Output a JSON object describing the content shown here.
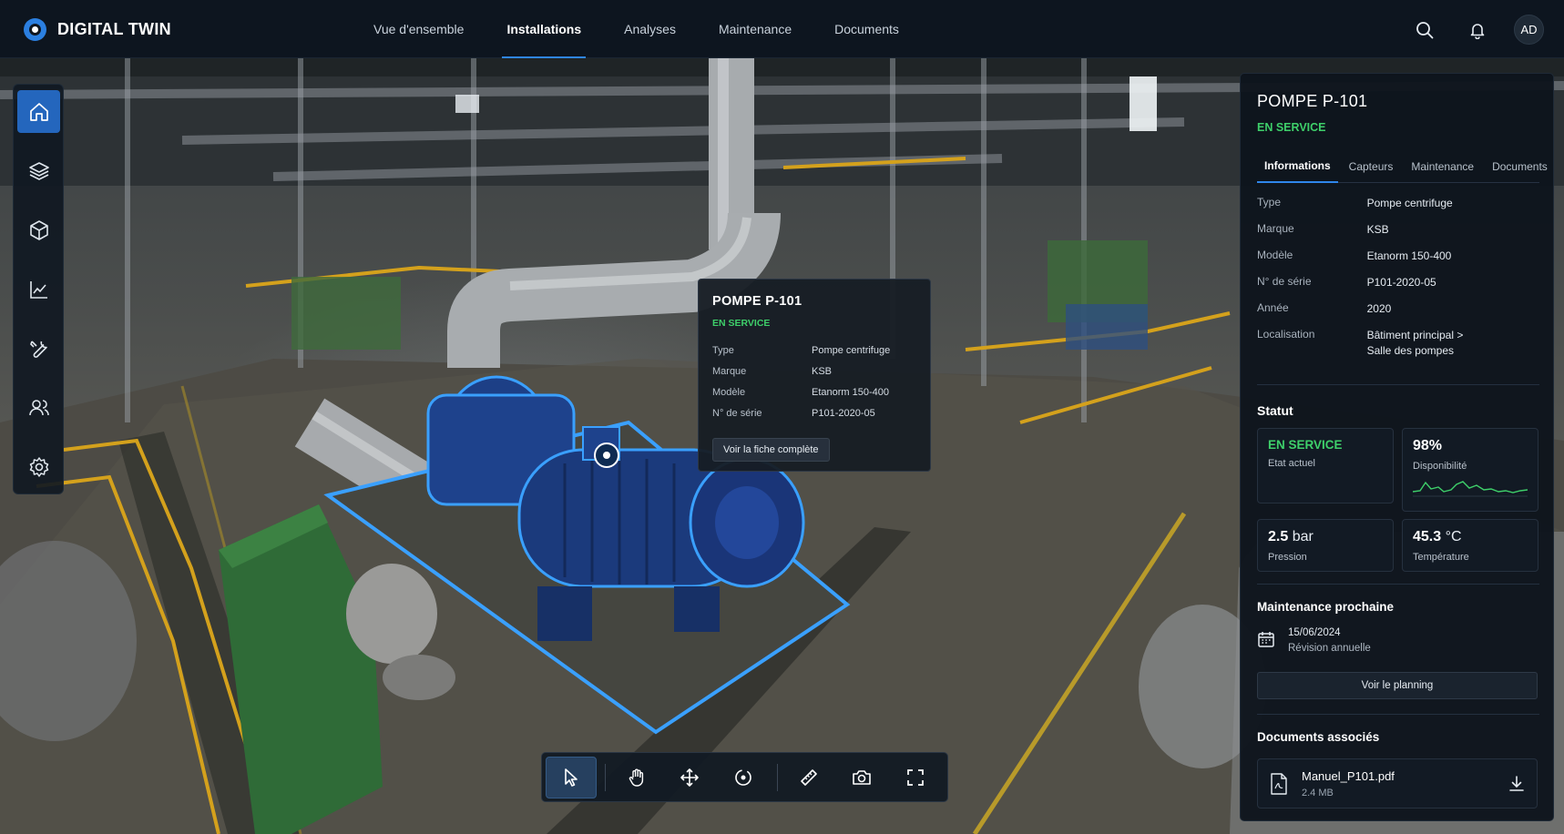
{
  "app": {
    "brand": "DIGITAL TWIN"
  },
  "nav": {
    "items": [
      {
        "label": "Vue d'ensemble",
        "active": false
      },
      {
        "label": "Installations",
        "active": true
      },
      {
        "label": "Analyses",
        "active": false
      },
      {
        "label": "Maintenance",
        "active": false
      },
      {
        "label": "Documents",
        "active": false
      }
    ]
  },
  "user": {
    "initials": "AD"
  },
  "left_rail": {
    "items": [
      {
        "icon": "home-icon",
        "active": true
      },
      {
        "icon": "layers-icon",
        "active": false
      },
      {
        "icon": "cube-icon",
        "active": false
      },
      {
        "icon": "chart-icon",
        "active": false
      },
      {
        "icon": "wrench-icon",
        "active": false
      },
      {
        "icon": "users-icon",
        "active": false
      },
      {
        "icon": "gear-icon",
        "active": false
      }
    ]
  },
  "popup": {
    "title": "POMPE P-101",
    "status": "EN SERVICE",
    "rows": [
      {
        "key": "Type",
        "value": "Pompe centrifuge"
      },
      {
        "key": "Marque",
        "value": "KSB"
      },
      {
        "key": "Modèle",
        "value": "Etanorm 150-400"
      },
      {
        "key": "N° de série",
        "value": "P101-2020-05"
      }
    ],
    "button": "Voir la fiche complète"
  },
  "toolbar": {
    "tools": [
      "select-icon",
      "pan-hand-icon",
      "move-icon",
      "orbit-icon",
      "measure-ruler-icon",
      "camera-icon",
      "fullscreen-icon"
    ],
    "active": "select-icon"
  },
  "panel": {
    "title": "POMPE P-101",
    "status": "EN SERVICE",
    "tabs": [
      {
        "label": "Informations",
        "active": true
      },
      {
        "label": "Capteurs",
        "active": false
      },
      {
        "label": "Maintenance",
        "active": false
      },
      {
        "label": "Documents",
        "active": false
      }
    ],
    "info": [
      {
        "key": "Type",
        "value": "Pompe centrifuge"
      },
      {
        "key": "Marque",
        "value": "KSB"
      },
      {
        "key": "Modèle",
        "value": "Etanorm 150-400"
      },
      {
        "key": "N° de série",
        "value": "P101-2020-05"
      },
      {
        "key": "Année",
        "value": "2020"
      },
      {
        "key": "Localisation",
        "value": "Bâtiment principal >",
        "value2": "Salle des pompes"
      }
    ],
    "statut": {
      "title": "Statut",
      "etat": {
        "value": "EN SERVICE",
        "label": "Etat actuel"
      },
      "disponibilite": {
        "value": "98%",
        "label": "Disponibilité"
      },
      "pression": {
        "value": "2.5",
        "unit": "bar",
        "label": "Pression"
      },
      "temperature": {
        "value": "45.3",
        "unit": "°C",
        "label": "Température"
      }
    },
    "maintenance": {
      "title": "Maintenance prochaine",
      "date": "15/06/2024",
      "description": "Révision annuelle",
      "button": "Voir le planning"
    },
    "documents": {
      "title": "Documents associés",
      "file": {
        "name": "Manuel_P101.pdf",
        "size": "2.4 MB"
      }
    }
  },
  "colors": {
    "accent": "#2f86ea",
    "status_green": "#3ecf6a",
    "highlight": "#3aa0ff",
    "pump_blue": "#1d3f86"
  }
}
